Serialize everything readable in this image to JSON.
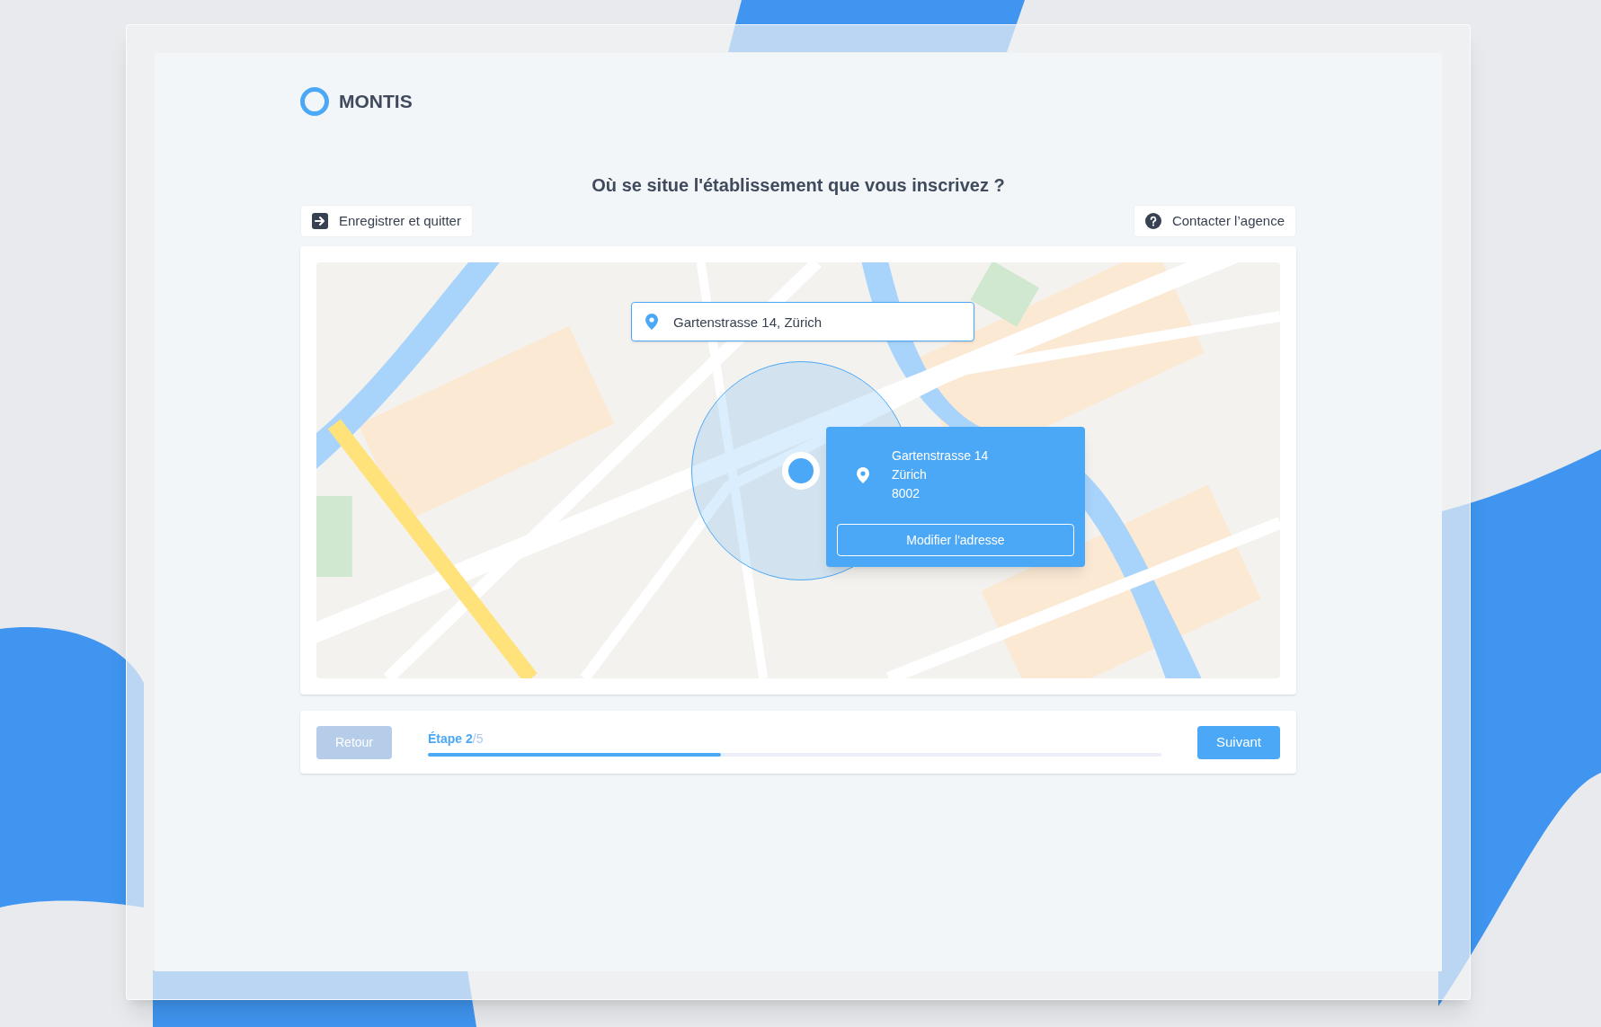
{
  "brand": {
    "name": "MONTIS"
  },
  "title": "Où se situe l'établissement que vous inscrivez ?",
  "actions": [
    {
      "kind": "exit",
      "label": "Enregistrer et quitter"
    },
    {
      "kind": "help",
      "label": "Contacter l’agence"
    }
  ],
  "map": {
    "kind": "picture",
    "search": {
      "value": "Gartenstrasse 14, Zürich"
    },
    "popup": {
      "lines": [
        "Gartenstrasse 14",
        "Zürich",
        "8002"
      ],
      "button": "Modifier l'adresse"
    }
  },
  "footer": {
    "back": {
      "label": "Retour",
      "disabled": true
    },
    "step": {
      "current": "Étape 2",
      "total": "/5",
      "level": 0.4
    },
    "next": {
      "label": "Suivant",
      "disabled": false
    }
  }
}
